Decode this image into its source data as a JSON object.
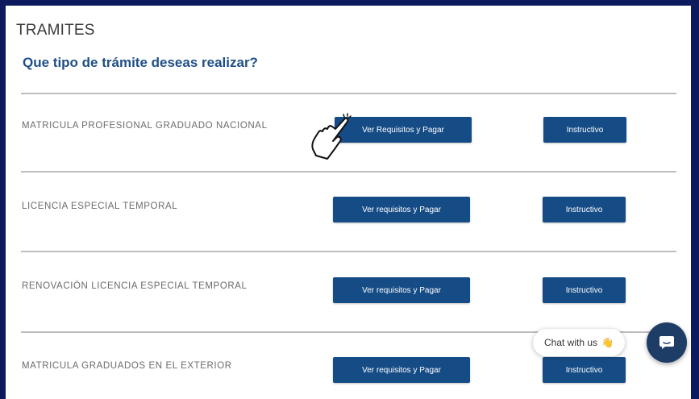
{
  "section_title": "TRAMITES",
  "question": "Que tipo de trámite deseas realizar?",
  "rows": [
    {
      "label": "MATRICULA PROFESIONAL GRADUADO NACIONAL",
      "primary_button": "Ver Requisitos y Pagar",
      "secondary_button": "Instructivo"
    },
    {
      "label": "LICENCIA ESPECIAL TEMPORAL",
      "primary_button": "Ver requisitos y Pagar",
      "secondary_button": "Instructivo"
    },
    {
      "label": "RENOVACIÓN LICENCIA ESPECIAL TEMPORAL",
      "primary_button": "Ver requisitos y Pagar",
      "secondary_button": "Instructivo"
    },
    {
      "label": "MATRICULA GRADUADOS EN EL EXTERIOR",
      "primary_button": "Ver requisitos y Pagar",
      "secondary_button": "Instructivo"
    }
  ],
  "chat": {
    "bubble_text": "Chat with us",
    "bubble_emoji": "👋",
    "launcher_icon": "chat-icon"
  },
  "colors": {
    "frame": "#0d1b5e",
    "button": "#164c86",
    "heading": "#1f4f85",
    "chat_launcher": "#1e3d66"
  },
  "cursor_icon": "pointer-hand-icon"
}
